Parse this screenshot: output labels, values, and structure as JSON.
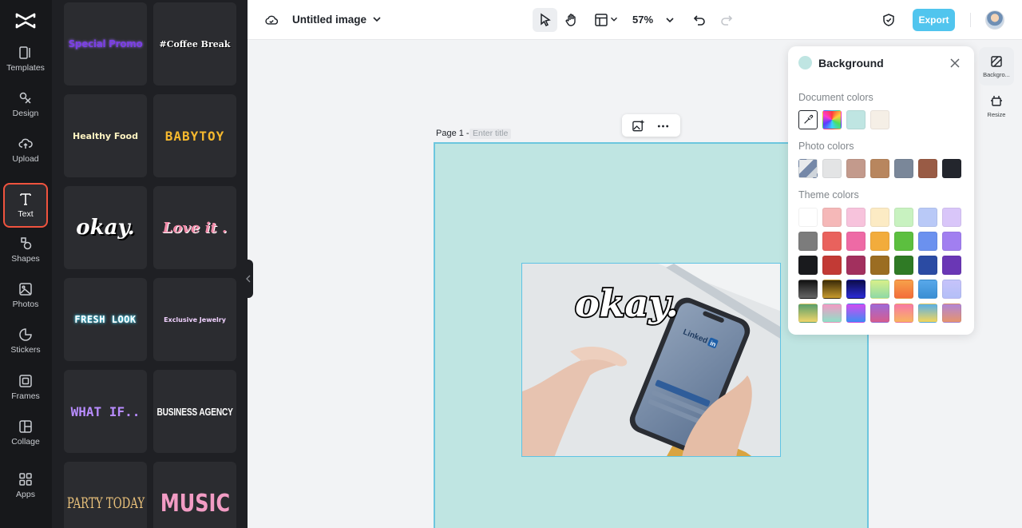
{
  "rail": {
    "items": [
      {
        "label": "Templates",
        "icon": "template-icon"
      },
      {
        "label": "Design",
        "icon": "design-icon"
      },
      {
        "label": "Upload",
        "icon": "upload-icon"
      },
      {
        "label": "Text",
        "icon": "text-icon",
        "active": true
      },
      {
        "label": "Shapes",
        "icon": "shapes-icon"
      },
      {
        "label": "Photos",
        "icon": "photos-icon"
      },
      {
        "label": "Stickers",
        "icon": "stickers-icon"
      },
      {
        "label": "Frames",
        "icon": "frames-icon"
      },
      {
        "label": "Collage",
        "icon": "collage-icon"
      },
      {
        "label": "Apps",
        "icon": "apps-icon"
      }
    ]
  },
  "text_styles": [
    "Special Promo",
    "#Coffee Break",
    "Healthy Food",
    "BABYTOY",
    "okay.",
    "Love it .",
    "FRESH LOOK",
    "Exclusive Jewelry",
    "WHAT IF..",
    "BUSINESS AGENCY",
    "PARTY TODAY",
    "MUSIC"
  ],
  "toolbar": {
    "doc_title": "Untitled image",
    "zoom": "57%",
    "export_label": "Export"
  },
  "canvas": {
    "page_label": "Page 1 -",
    "title_placeholder": "Enter title",
    "photo_text": "okay."
  },
  "background_panel": {
    "title": "Background",
    "current_color": "#bfe5e2",
    "document_colors_label": "Document colors",
    "document_colors": [
      "#bfe5e2",
      "#f5efe6"
    ],
    "photo_colors_label": "Photo colors",
    "photo_colors": [
      "#e3e4e5",
      "#c39a8c",
      "#b8865e",
      "#7a8799",
      "#995b45",
      "#23262d"
    ],
    "theme_colors_label": "Theme colors",
    "theme_colors": [
      [
        "#ffffff",
        "#f5b8b8",
        "#f7c3dc",
        "#fcebc4",
        "#c8f2c0",
        "#b9c9f7",
        "#d9c6f9"
      ],
      [
        "#7c7c7c",
        "#e9625d",
        "#ee6aa5",
        "#f2ac3c",
        "#5cbf3f",
        "#6b91ef",
        "#a17ff0"
      ],
      [
        "#191a1d",
        "#c23a35",
        "#a2305e",
        "#9b6d22",
        "#2f7a25",
        "#2b4ba3",
        "#6a37b5"
      ],
      [
        "linear-gradient(180deg,#111,#666)",
        "linear-gradient(180deg,#3a2a08,#c79a2c)",
        "linear-gradient(180deg,#0d0d4a,#2b2bd6)",
        "linear-gradient(180deg,#d8f08a,#8fd9a6)",
        "linear-gradient(180deg,#f7a14a,#f36d3a)",
        "linear-gradient(180deg,#58a8ea,#3a8ed3)",
        "linear-gradient(180deg,#c6c3fa,#b4bff8)"
      ],
      [
        "linear-gradient(180deg,#5a9e6b,#f0d66a)",
        "linear-gradient(180deg,#f49ac4,#8fe0c8)",
        "linear-gradient(180deg,#d24cf0,#3e8cf4)",
        "linear-gradient(180deg,#9d6ad8,#d65d8e)",
        "linear-gradient(180deg,#f77aa6,#f9b45f)",
        "linear-gradient(180deg,#5ab0e6,#f3d65a)",
        "linear-gradient(180deg,#b185d6,#e6946d)"
      ]
    ]
  },
  "side_tools": [
    {
      "label": "Backgro...",
      "icon": "background-icon",
      "active": true
    },
    {
      "label": "Resize",
      "icon": "resize-icon"
    }
  ]
}
